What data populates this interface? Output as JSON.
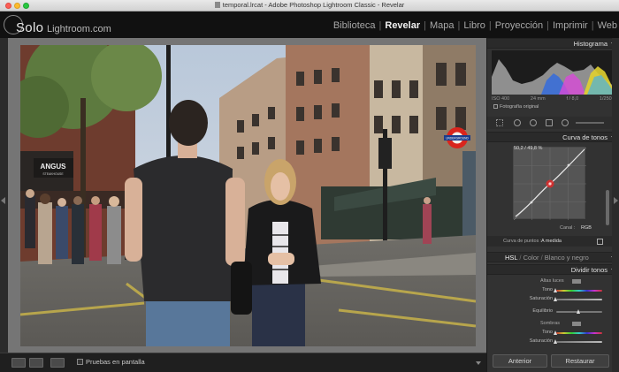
{
  "window": {
    "title": "temporal.lrcat - Adobe Photoshop Lightroom Classic - Revelar"
  },
  "logo": {
    "solo": "Solo",
    "rest": "Lightroom.com"
  },
  "modules": [
    "Biblioteca",
    "Revelar",
    "Mapa",
    "Libro",
    "Proyección",
    "Imprimir",
    "Web"
  ],
  "active_module": "Revelar",
  "photo": {
    "signs": {
      "angus": "ANGUS",
      "steakhouse": "STEAKHOUSE",
      "underground": "UNDERGROUND"
    }
  },
  "toolbar": {
    "proof_label": "Pruebas en pantalla"
  },
  "panel": {
    "histogram": {
      "title": "Histograma",
      "info": [
        "ISO 400",
        "24 mm",
        "f / 8,0",
        "1/250 s"
      ],
      "original_photo": "Fotografía original"
    },
    "tone_curve": {
      "title": "Curva de tonos",
      "readout": "50,2 / 49,8 %",
      "channel_label": "Canal :",
      "channel_value": "RGB",
      "point_curve_label": "Curva de puntos :",
      "point_curve_value": "A medida"
    },
    "hsl": {
      "hsl": "HSL",
      "color": "Color",
      "bw": "Blanco y negro"
    },
    "split_toning": {
      "title": "Dividir tonos",
      "highlights": "Altas luces",
      "hue_label": "Tono",
      "hue_value": "0",
      "sat_label": "Saturación",
      "sat_value": "0",
      "balance_label": "Equilibrio",
      "balance_value": "0",
      "shadows": "Sombras",
      "shadow_hue_label": "Tono",
      "shadow_hue_value": "0",
      "shadow_sat_label": "Saturación",
      "shadow_sat_value": "0"
    },
    "buttons": {
      "previous": "Anterior",
      "reset": "Restaurar"
    }
  },
  "colors": {
    "accent_red": "#e02a2a",
    "panel_bg": "#323232",
    "header_bg": "#111111"
  }
}
